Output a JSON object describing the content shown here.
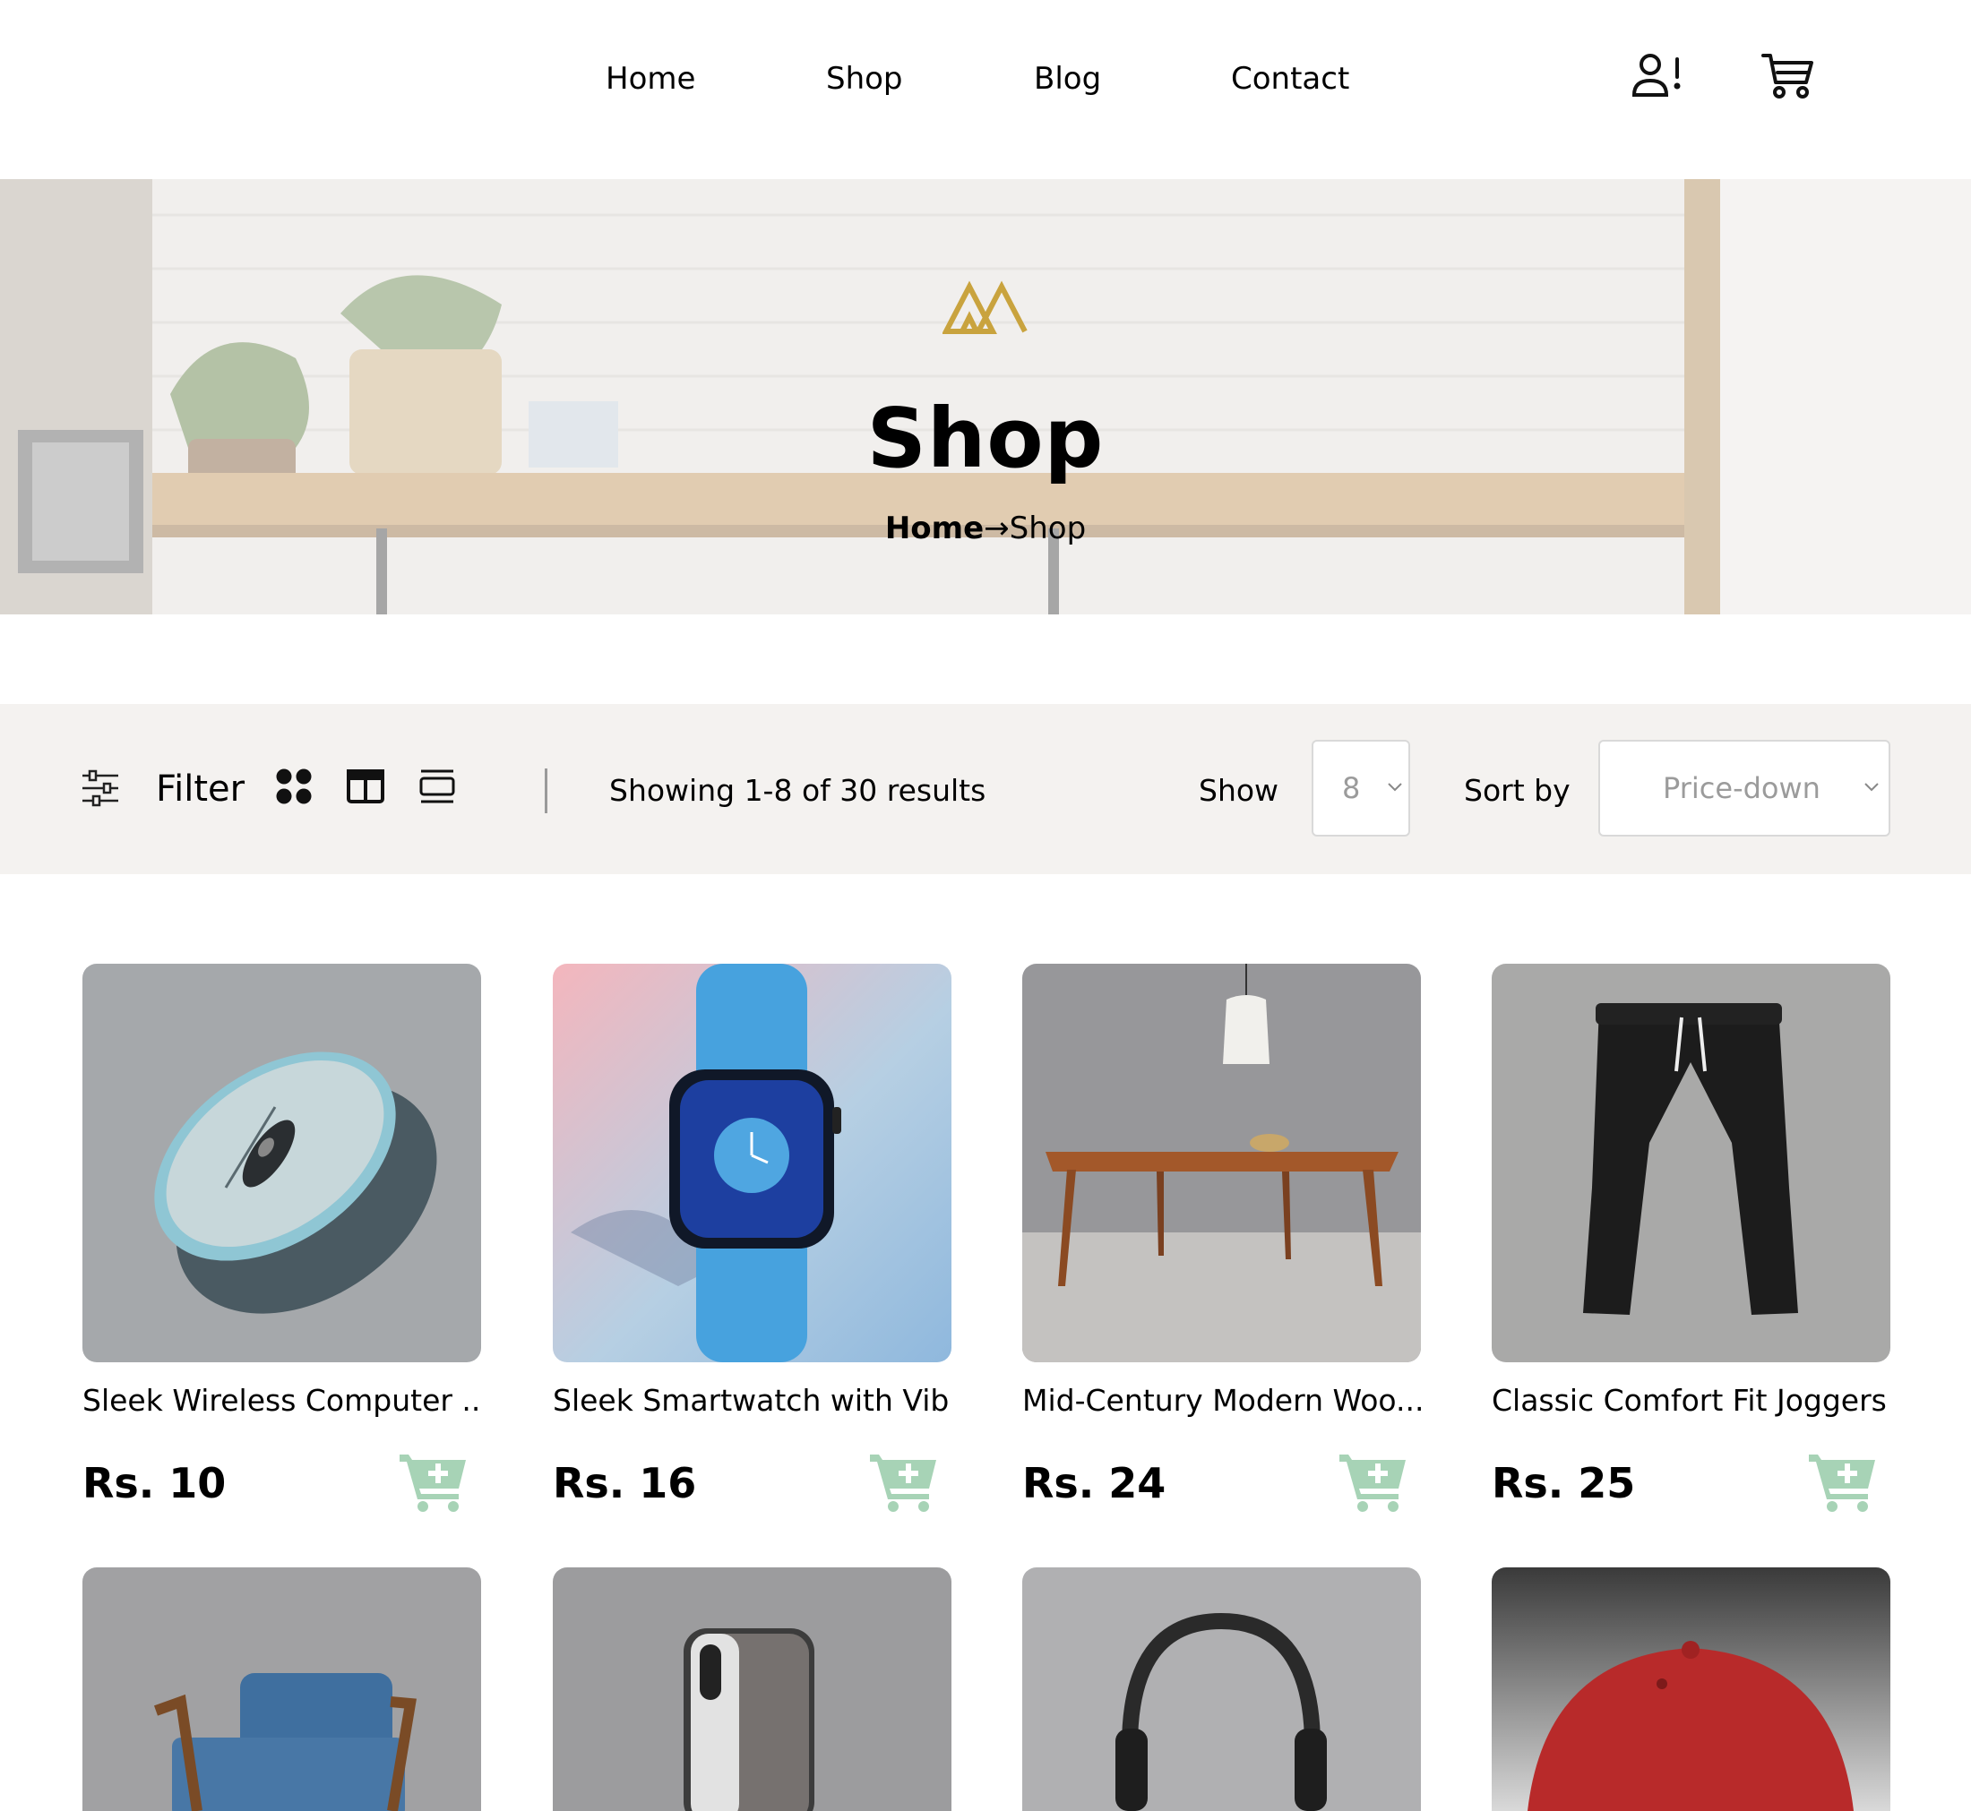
{
  "nav": {
    "links": [
      "Home",
      "Shop",
      "Blog",
      "Contact"
    ],
    "account_icon": "user-alert-icon",
    "cart_icon": "cart-icon"
  },
  "hero": {
    "logo_icon": "brand-logo-icon",
    "title": "Shop",
    "breadcrumb_home": "Home",
    "breadcrumb_separator": "→",
    "breadcrumb_current": "Shop"
  },
  "toolbar": {
    "filter_label": "Filter",
    "filter_icon": "sliders-icon",
    "view_icons": [
      "grid-four-icon",
      "two-column-icon",
      "list-view-icon"
    ],
    "results_text": "Showing 1-8 of 30 results",
    "show_label": "Show",
    "show_value": "8",
    "sort_label": "Sort by",
    "sort_value": "Price-down"
  },
  "products": [
    {
      "name": "Sleek Wireless Computer ...",
      "price": "Rs. 10"
    },
    {
      "name": "Sleek Smartwatch with Vib...",
      "price": "Rs. 16"
    },
    {
      "name": "Mid-Century Modern Woo...",
      "price": "Rs. 24"
    },
    {
      "name": "Classic Comfort Fit Joggers",
      "price": "Rs. 25"
    },
    {
      "name": "",
      "price": ""
    },
    {
      "name": "",
      "price": ""
    },
    {
      "name": "",
      "price": ""
    },
    {
      "name": "",
      "price": ""
    }
  ],
  "colors": {
    "accent_gold": "#c9a33e",
    "cart_green": "#a7d3b6",
    "filter_bar_bg": "#f4f2f0"
  }
}
